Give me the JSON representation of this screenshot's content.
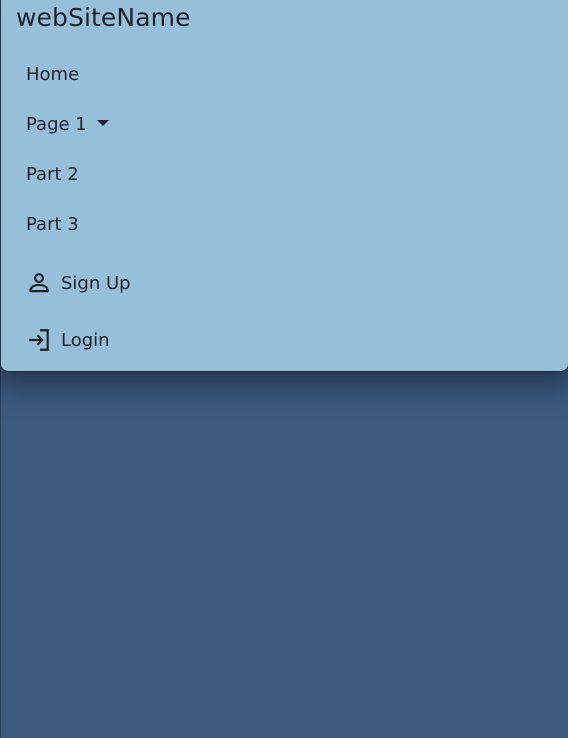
{
  "brand": "webSiteName",
  "nav": {
    "home": "Home",
    "page1": "Page 1",
    "part2": "Part 2",
    "part3": "Part 3",
    "signup": "Sign Up",
    "login": "Login"
  },
  "icons": {
    "page1_dropdown": "caret-down-icon",
    "signup": "person-icon",
    "login": "login-icon"
  },
  "colors": {
    "navbar_bg": "#96bfd9",
    "page_bg": "#3d5b81",
    "text": "#1e2328"
  }
}
